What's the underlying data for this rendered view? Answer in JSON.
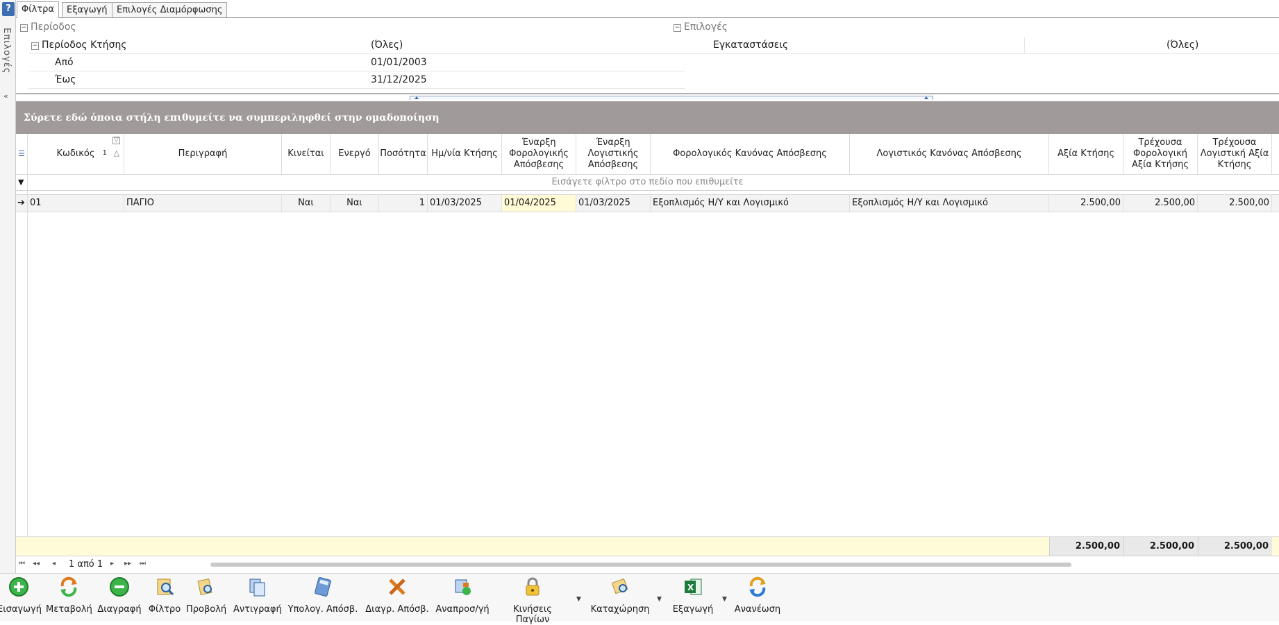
{
  "sidebar": {
    "help": "?",
    "vertical_label": "Επιλογές",
    "collapse": "«"
  },
  "tabs": [
    {
      "label": "Φίλτρα"
    },
    {
      "label": "Εξαγωγή"
    },
    {
      "label": "Επιλογές Διαμόρφωσης"
    }
  ],
  "filters": {
    "period_group": "Περίοδος",
    "acquisition_period": {
      "label": "Περίοδος Κτήσης",
      "value": "(Όλες)"
    },
    "from": {
      "label": "Από",
      "value": "01/01/2003"
    },
    "to": {
      "label": "Έως",
      "value": "31/12/2025"
    },
    "options_group": "Επιλογές",
    "installations": {
      "label": "Εγκαταστάσεις",
      "value": "(Όλες)"
    }
  },
  "grid": {
    "group_panel_text": "Σύρετε εδώ όποια στήλη επιθυμείτε να συμπεριληφθεί στην ομαδοποίηση",
    "filter_hint": "Εισάγετε φίλτρο στο πεδίο που επιθυμείτε",
    "sort_index": "1",
    "columns": [
      "Κωδικός",
      "Περιγραφή",
      "Κινείται",
      "Ενεργό",
      "Ποσότητα",
      "Ημ/νία Κτήσης",
      "Έναρξη Φορολογικής Απόσβεσης",
      "Έναρξη Λογιστικής Απόσβεσης",
      "Φορολογικός Κανόνας Απόσβεσης",
      "Λογιστικός Κανόνας Απόσβεσης",
      "Αξία Κτήσης",
      "Τρέχουσα Φορολογική Αξία Κτήσης",
      "Τρέχουσα Λογιστική Αξία Κτήσης"
    ],
    "rows": [
      [
        "01",
        "ΠΑΓΙΟ",
        "Ναι",
        "Ναι",
        "1",
        "01/03/2025",
        "01/04/2025",
        "01/03/2025",
        "Εξοπλισμός Η/Υ και Λογισμικό",
        "Εξοπλισμός Η/Υ και Λογισμικό",
        "2.500,00",
        "2.500,00",
        "2.500,00"
      ]
    ],
    "totals": [
      "2.500,00",
      "2.500,00",
      "2.500,00"
    ]
  },
  "navigator": {
    "page_text": "1 από 1"
  },
  "toolbar": {
    "insert": "Εισαγωγή",
    "edit": "Μεταβολή",
    "delete": "Διαγραφή",
    "filter": "Φίλτρο",
    "view": "Προβολή",
    "copy": "Αντιγραφή",
    "calc_depr": "Υπολογ. Απόσβ.",
    "delete_depr": "Διαγρ. Απόσβ.",
    "revaluation": "Αναπροσ/γή",
    "asset_movements": "Κινήσεις Παγίων",
    "posting": "Καταχώρηση",
    "export": "Εξαγωγή",
    "refresh": "Ανανέωση"
  }
}
